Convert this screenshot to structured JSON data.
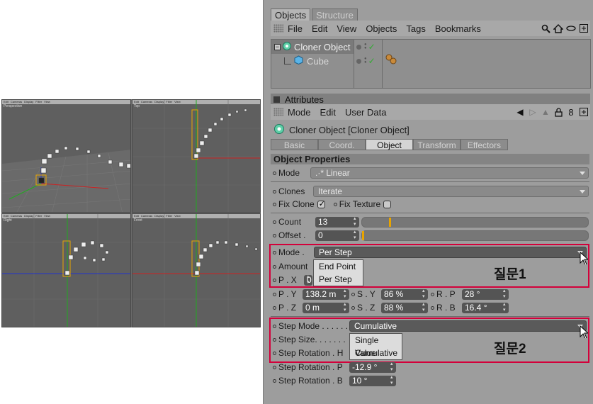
{
  "viewports": {
    "menu": [
      "Edit",
      "Cameras",
      "Display",
      "Filter",
      "View"
    ],
    "labels": [
      "Perspective",
      "Top",
      "Right",
      "Front"
    ]
  },
  "panel": {
    "tabs": [
      "Objects",
      "Structure"
    ],
    "menu": [
      "File",
      "Edit",
      "View",
      "Objects",
      "Tags",
      "Bookmarks"
    ],
    "tree": [
      {
        "name": "Cloner Object",
        "icon": "cloner-icon",
        "selected": true
      },
      {
        "name": "Cube",
        "icon": "cube-icon",
        "selected": false
      }
    ],
    "attributes_title": "Attributes",
    "attr_menu": [
      "Mode",
      "Edit",
      "User Data"
    ],
    "object_title": "Cloner Object [Cloner Object]",
    "attr_tabs": [
      "Basic",
      "Coord.",
      "Object",
      "Transform",
      "Effectors"
    ],
    "active_attr_tab": "Object",
    "section": "Object Properties"
  },
  "props": {
    "mode_label": "Mode",
    "mode_value": ".·* Linear",
    "clones_label": "Clones",
    "clones_value": "Iterate",
    "fix_clone_label": "Fix Clone",
    "fix_texture_label": "Fix Texture",
    "count_label": "Count",
    "count_value": "13",
    "offset_label": "Offset .",
    "offset_value": "0",
    "mode2_label": "Mode .",
    "mode2_value": "Per Step",
    "amount_label": "Amount",
    "px_label": "P . X",
    "px_value": "0",
    "popup1": [
      "End Point",
      "Per Step"
    ],
    "py_label": "P . Y",
    "py_value": "138.2 m",
    "sy_label": "S . Y",
    "sy_value": "86 %",
    "rp_label": "R . P",
    "rp_value": "28 °",
    "pz_label": "P . Z",
    "pz_value": "0 m",
    "sz_label": "S . Z",
    "sz_value": "88 %",
    "rb_label": "R . B",
    "rb_value": "16.4 °",
    "step_mode_label": "Step Mode . . . . . .",
    "step_mode_value": "Cumulative",
    "step_size_label": "Step Size. . . . . . .",
    "step_rot_h_label": "Step Rotation . H",
    "popup2": [
      "Single Value",
      "Cumulative"
    ],
    "step_rot_p_label": "Step Rotation . P",
    "step_rot_p_value": "-12.9 °",
    "step_rot_b_label": "Step Rotation . B",
    "step_rot_b_value": "10 °"
  },
  "annotations": {
    "q1": "질문1",
    "q2": "질문2",
    "box_color": "#d3003a"
  }
}
